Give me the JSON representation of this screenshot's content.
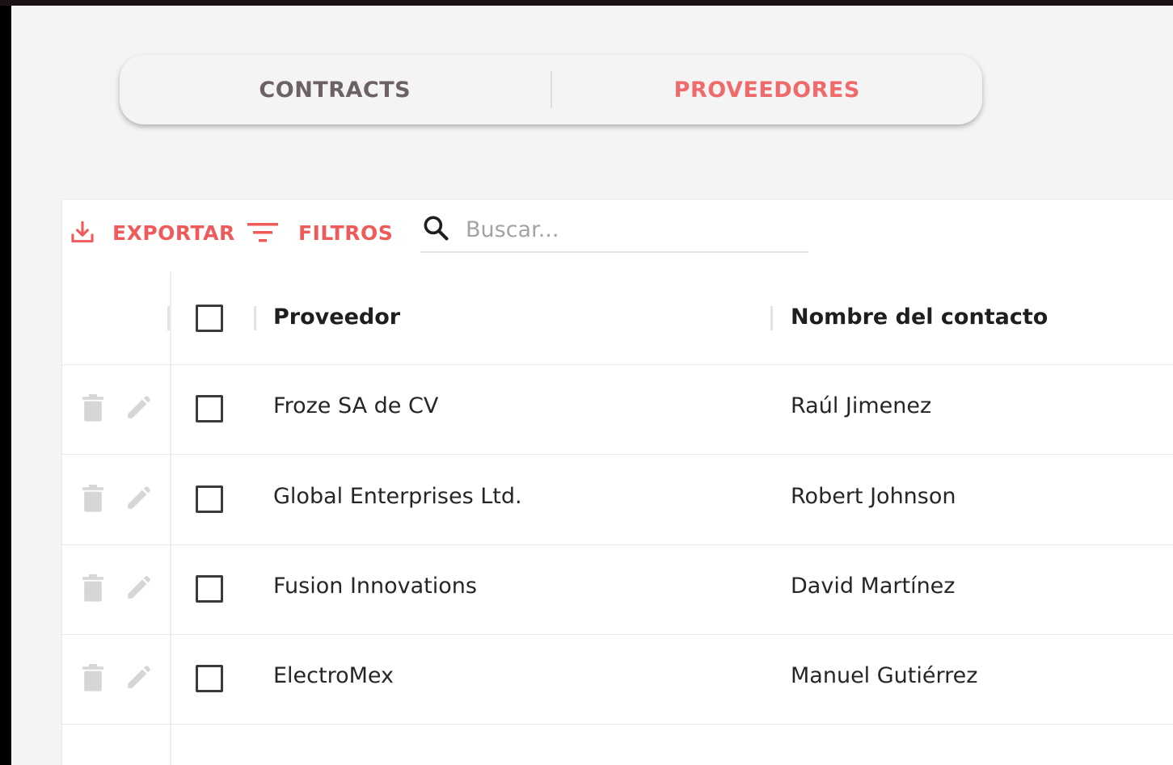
{
  "tabs": [
    {
      "label": "CONTRACTS",
      "active": false
    },
    {
      "label": "PROVEEDORES",
      "active": true
    }
  ],
  "toolbar": {
    "export_label": "EXPORTAR",
    "filters_label": "FILTROS",
    "search_placeholder": "Buscar...",
    "search_value": ""
  },
  "table": {
    "columns": [
      "Proveedor",
      "Nombre del contacto"
    ],
    "rows": [
      {
        "proveedor": "Froze SA de CV",
        "contacto": "Raúl Jimenez"
      },
      {
        "proveedor": "Global Enterprises Ltd.",
        "contacto": "Robert Johnson"
      },
      {
        "proveedor": "Fusion Innovations",
        "contacto": "David Martínez"
      },
      {
        "proveedor": "ElectroMex",
        "contacto": "Manuel Gutiérrez"
      }
    ]
  },
  "icons": {
    "export": "download-icon",
    "filters": "filter-icon",
    "search": "search-icon",
    "row_delete": "trash-icon",
    "row_edit": "pencil-icon"
  },
  "colors": {
    "accent": "#ef5b5b",
    "tab_inactive": "#6b6166",
    "row_icon": "#d6d6d6"
  }
}
